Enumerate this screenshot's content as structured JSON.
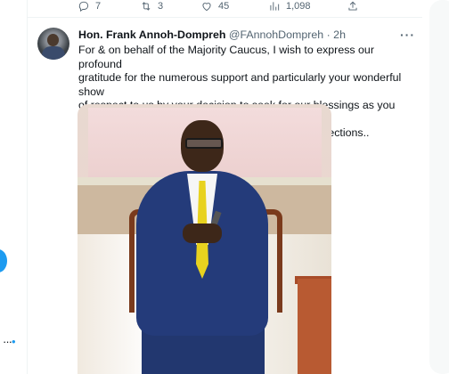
{
  "previous_tweet": {
    "actions": [
      {
        "name": "reply",
        "icon": "reply-icon",
        "count": "7"
      },
      {
        "name": "retweet",
        "icon": "retweet-icon",
        "count": "3"
      },
      {
        "name": "like",
        "icon": "heart-icon",
        "count": "45"
      },
      {
        "name": "views",
        "icon": "views-icon",
        "count": "1,098"
      },
      {
        "name": "share",
        "icon": "share-icon",
        "count": ""
      }
    ]
  },
  "tweet": {
    "author_name": "Hon. Frank Annoh-Dompreh",
    "author_handle": "@FAnnohDompreh",
    "separator": " · ",
    "time": "2h",
    "more": "···",
    "text_lines": [
      "For & on behalf of the Majority Caucus, I wish to express our profound",
      "gratitude for the numerous support and particularly your wonderful show",
      "of respect to us by your decision to seek for our blessings as you decide",
      "to lead our great party towards the 2024 General elections.."
    ]
  },
  "sidebar": {
    "more_label": "···"
  },
  "colors": {
    "accent": "#1d9bf0",
    "text": "#0f1419",
    "muted": "#536471",
    "border": "#eff3f4"
  }
}
